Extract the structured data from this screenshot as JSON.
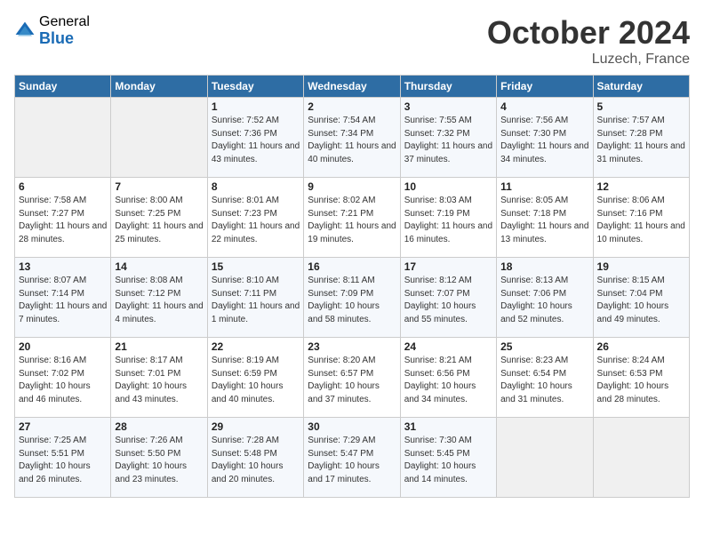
{
  "header": {
    "logo_general": "General",
    "logo_blue": "Blue",
    "month": "October 2024",
    "location": "Luzech, France"
  },
  "weekdays": [
    "Sunday",
    "Monday",
    "Tuesday",
    "Wednesday",
    "Thursday",
    "Friday",
    "Saturday"
  ],
  "weeks": [
    [
      {
        "day": "",
        "empty": true
      },
      {
        "day": "",
        "empty": true
      },
      {
        "day": "1",
        "sunrise": "7:52 AM",
        "sunset": "7:36 PM",
        "daylight": "11 hours and 43 minutes."
      },
      {
        "day": "2",
        "sunrise": "7:54 AM",
        "sunset": "7:34 PM",
        "daylight": "11 hours and 40 minutes."
      },
      {
        "day": "3",
        "sunrise": "7:55 AM",
        "sunset": "7:32 PM",
        "daylight": "11 hours and 37 minutes."
      },
      {
        "day": "4",
        "sunrise": "7:56 AM",
        "sunset": "7:30 PM",
        "daylight": "11 hours and 34 minutes."
      },
      {
        "day": "5",
        "sunrise": "7:57 AM",
        "sunset": "7:28 PM",
        "daylight": "11 hours and 31 minutes."
      }
    ],
    [
      {
        "day": "6",
        "sunrise": "7:58 AM",
        "sunset": "7:27 PM",
        "daylight": "11 hours and 28 minutes."
      },
      {
        "day": "7",
        "sunrise": "8:00 AM",
        "sunset": "7:25 PM",
        "daylight": "11 hours and 25 minutes."
      },
      {
        "day": "8",
        "sunrise": "8:01 AM",
        "sunset": "7:23 PM",
        "daylight": "11 hours and 22 minutes."
      },
      {
        "day": "9",
        "sunrise": "8:02 AM",
        "sunset": "7:21 PM",
        "daylight": "11 hours and 19 minutes."
      },
      {
        "day": "10",
        "sunrise": "8:03 AM",
        "sunset": "7:19 PM",
        "daylight": "11 hours and 16 minutes."
      },
      {
        "day": "11",
        "sunrise": "8:05 AM",
        "sunset": "7:18 PM",
        "daylight": "11 hours and 13 minutes."
      },
      {
        "day": "12",
        "sunrise": "8:06 AM",
        "sunset": "7:16 PM",
        "daylight": "11 hours and 10 minutes."
      }
    ],
    [
      {
        "day": "13",
        "sunrise": "8:07 AM",
        "sunset": "7:14 PM",
        "daylight": "11 hours and 7 minutes."
      },
      {
        "day": "14",
        "sunrise": "8:08 AM",
        "sunset": "7:12 PM",
        "daylight": "11 hours and 4 minutes."
      },
      {
        "day": "15",
        "sunrise": "8:10 AM",
        "sunset": "7:11 PM",
        "daylight": "11 hours and 1 minute."
      },
      {
        "day": "16",
        "sunrise": "8:11 AM",
        "sunset": "7:09 PM",
        "daylight": "10 hours and 58 minutes."
      },
      {
        "day": "17",
        "sunrise": "8:12 AM",
        "sunset": "7:07 PM",
        "daylight": "10 hours and 55 minutes."
      },
      {
        "day": "18",
        "sunrise": "8:13 AM",
        "sunset": "7:06 PM",
        "daylight": "10 hours and 52 minutes."
      },
      {
        "day": "19",
        "sunrise": "8:15 AM",
        "sunset": "7:04 PM",
        "daylight": "10 hours and 49 minutes."
      }
    ],
    [
      {
        "day": "20",
        "sunrise": "8:16 AM",
        "sunset": "7:02 PM",
        "daylight": "10 hours and 46 minutes."
      },
      {
        "day": "21",
        "sunrise": "8:17 AM",
        "sunset": "7:01 PM",
        "daylight": "10 hours and 43 minutes."
      },
      {
        "day": "22",
        "sunrise": "8:19 AM",
        "sunset": "6:59 PM",
        "daylight": "10 hours and 40 minutes."
      },
      {
        "day": "23",
        "sunrise": "8:20 AM",
        "sunset": "6:57 PM",
        "daylight": "10 hours and 37 minutes."
      },
      {
        "day": "24",
        "sunrise": "8:21 AM",
        "sunset": "6:56 PM",
        "daylight": "10 hours and 34 minutes."
      },
      {
        "day": "25",
        "sunrise": "8:23 AM",
        "sunset": "6:54 PM",
        "daylight": "10 hours and 31 minutes."
      },
      {
        "day": "26",
        "sunrise": "8:24 AM",
        "sunset": "6:53 PM",
        "daylight": "10 hours and 28 minutes."
      }
    ],
    [
      {
        "day": "27",
        "sunrise": "7:25 AM",
        "sunset": "5:51 PM",
        "daylight": "10 hours and 26 minutes."
      },
      {
        "day": "28",
        "sunrise": "7:26 AM",
        "sunset": "5:50 PM",
        "daylight": "10 hours and 23 minutes."
      },
      {
        "day": "29",
        "sunrise": "7:28 AM",
        "sunset": "5:48 PM",
        "daylight": "10 hours and 20 minutes."
      },
      {
        "day": "30",
        "sunrise": "7:29 AM",
        "sunset": "5:47 PM",
        "daylight": "10 hours and 17 minutes."
      },
      {
        "day": "31",
        "sunrise": "7:30 AM",
        "sunset": "5:45 PM",
        "daylight": "10 hours and 14 minutes."
      },
      {
        "day": "",
        "empty": true
      },
      {
        "day": "",
        "empty": true
      }
    ]
  ]
}
